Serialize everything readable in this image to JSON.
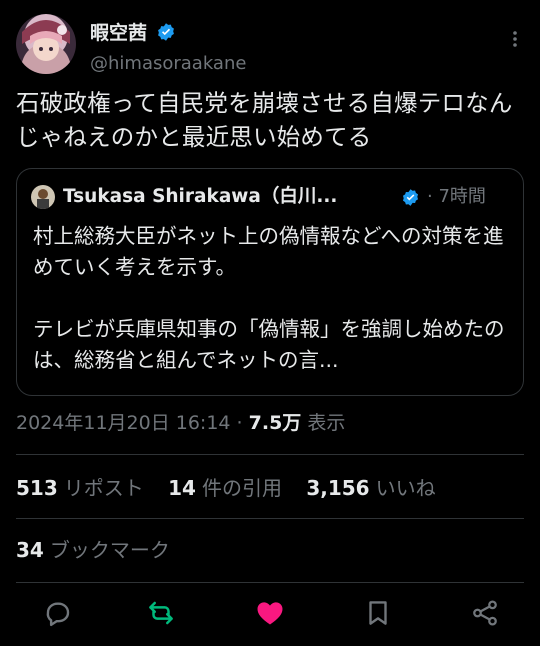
{
  "author": {
    "display_name": "暇空茜",
    "handle": "@himasoraakane"
  },
  "tweet": {
    "text": "石破政権って自民党を崩壊させる自爆テロなんじゃねえのかと最近思い始めてる"
  },
  "quote": {
    "author_name": "Tsukasa Shirakawa（白川...",
    "time": "· 7時間",
    "paragraph1": "村上総務大臣がネット上の偽情報などへの対策を進めていく考えを示す。",
    "paragraph2": "テレビが兵庫県知事の「偽情報」を強調し始めたのは、総務省と組んでネットの言..."
  },
  "meta": {
    "timestamp": "2024年11月20日 16:14 · ",
    "views": "7.5万",
    "views_label": " 表示"
  },
  "stats": {
    "reposts": {
      "count": "513",
      "label": "リポスト"
    },
    "quotes": {
      "count": "14",
      "label": "件の引用"
    },
    "likes": {
      "count": "3,156",
      "label": "いいね"
    },
    "bookmarks": {
      "count": "34",
      "label": "ブックマーク"
    }
  },
  "colors": {
    "background": "#000000",
    "text": "#e7e9ea",
    "secondary": "#71767b",
    "border": "#2f3336",
    "verified": "#1d9bf0",
    "repost_active": "#00ba7c",
    "like_active": "#f91880"
  },
  "icons": [
    "more-icon",
    "verified-icon",
    "reply-icon",
    "repost-icon",
    "like-icon",
    "bookmark-icon",
    "share-icon"
  ]
}
